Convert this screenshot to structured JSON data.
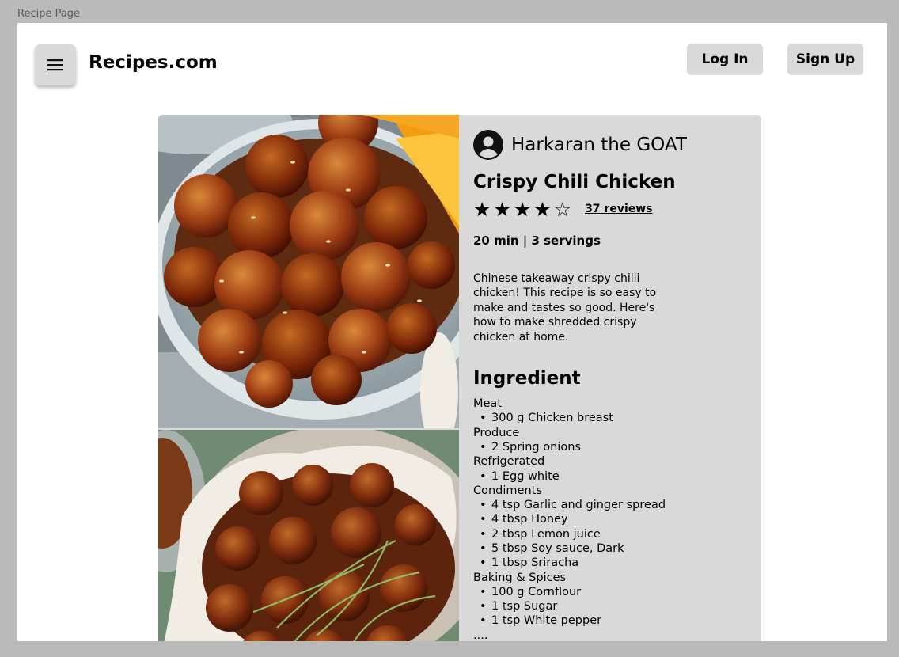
{
  "window": {
    "title": "Recipe Page"
  },
  "header": {
    "site_title": "Recipes.com",
    "login_label": "Log In",
    "signup_label": "Sign Up"
  },
  "recipe": {
    "author": "Harkaran the GOAT",
    "title": "Crispy Chili Chicken",
    "rating": {
      "value": 4,
      "max": 5,
      "stars_text": "★★★★☆",
      "reviews_label": "37 reviews"
    },
    "meta": "20 min | 3 servings",
    "description": "Chinese takeaway crispy chilli chicken! This recipe is so easy to make and tastes so good. Here's how to make shredded crispy chicken at home.",
    "ingredient_heading": "Ingredient",
    "ingredient_groups": [
      {
        "label": "Meat",
        "items": [
          "300 g Chicken breast"
        ]
      },
      {
        "label": "Produce",
        "items": [
          "2 Spring onions"
        ]
      },
      {
        "label": "Refrigerated",
        "items": [
          "1 Egg white"
        ]
      },
      {
        "label": "Condiments",
        "items": [
          "4 tsp Garlic and ginger spread",
          "4 tbsp Honey",
          "2 tbsp Lemon juice",
          "5 tbsp Soy sauce, Dark",
          "1 tbsp Sriracha"
        ]
      },
      {
        "label": "Baking & Spices",
        "items": [
          "100 g Cornflour",
          "1 tsp Sugar",
          "1 tsp White pepper"
        ]
      }
    ],
    "more_indicator": "...."
  },
  "colors": {
    "frame_bg": "#b9b9b9",
    "canvas_bg": "#ffffff",
    "button_bg": "#d9d9d9",
    "card_bg": "#d9d9d9"
  },
  "icons": {
    "menu": "hamburger-menu-icon",
    "avatar": "user-avatar-icon"
  }
}
